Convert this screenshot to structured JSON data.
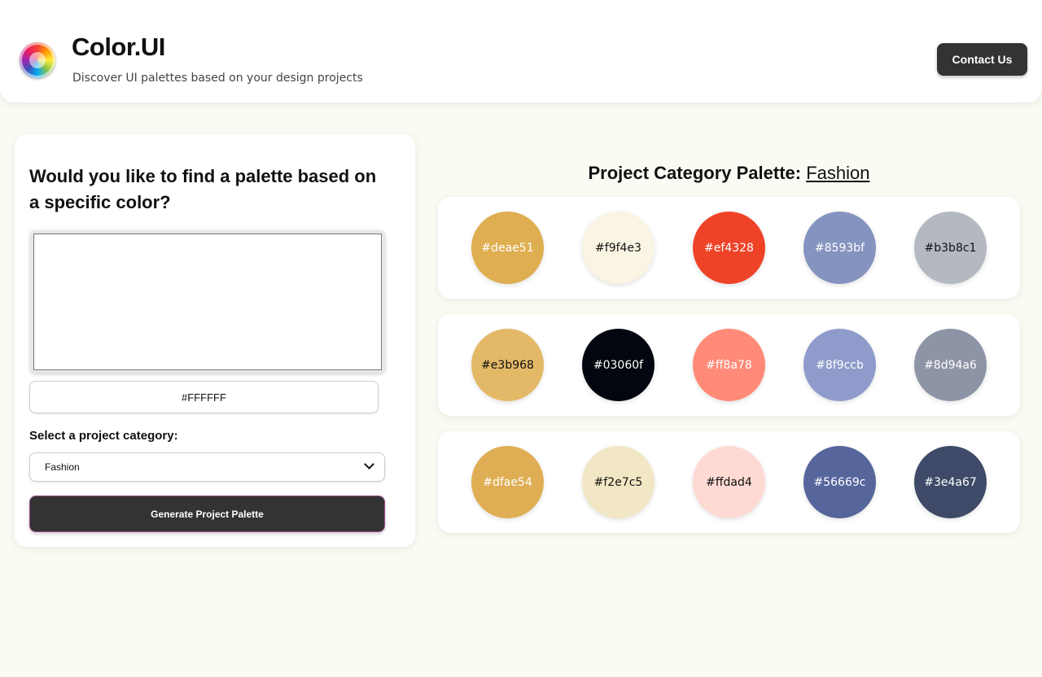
{
  "header": {
    "logo_icon": "color-wheel-icon",
    "title": "Color.UI",
    "subtitle": "Discover UI palettes based on your design projects",
    "contact_label": "Contact Us"
  },
  "form": {
    "heading": "Would you like to find a palette based on a specific color?",
    "picker_color": "#FFFFFF",
    "hex_value": "#FFFFFF",
    "category_label": "Select a project category:",
    "category_selected": "Fashion",
    "generate_label": "Generate Project Palette"
  },
  "palette": {
    "title_prefix": "Project Category Palette:",
    "category": "Fashion",
    "rows": [
      [
        {
          "hex": "#deae51",
          "text_color": "#ffffff"
        },
        {
          "hex": "#f9f4e3",
          "text_color": "#111111"
        },
        {
          "hex": "#ef4328",
          "text_color": "#ffffff"
        },
        {
          "hex": "#8593bf",
          "text_color": "#ffffff"
        },
        {
          "hex": "#b3b8c1",
          "text_color": "#111111"
        }
      ],
      [
        {
          "hex": "#e3b968",
          "text_color": "#111111"
        },
        {
          "hex": "#03060f",
          "text_color": "#ffffff"
        },
        {
          "hex": "#ff8a78",
          "text_color": "#ffffff"
        },
        {
          "hex": "#8f9ccb",
          "text_color": "#ffffff"
        },
        {
          "hex": "#8d94a6",
          "text_color": "#ffffff"
        }
      ],
      [
        {
          "hex": "#dfae54",
          "text_color": "#ffffff"
        },
        {
          "hex": "#f2e7c5",
          "text_color": "#111111"
        },
        {
          "hex": "#ffdad4",
          "text_color": "#111111"
        },
        {
          "hex": "#56669c",
          "text_color": "#ffffff"
        },
        {
          "hex": "#3e4a67",
          "text_color": "#ffffff"
        }
      ]
    ]
  }
}
